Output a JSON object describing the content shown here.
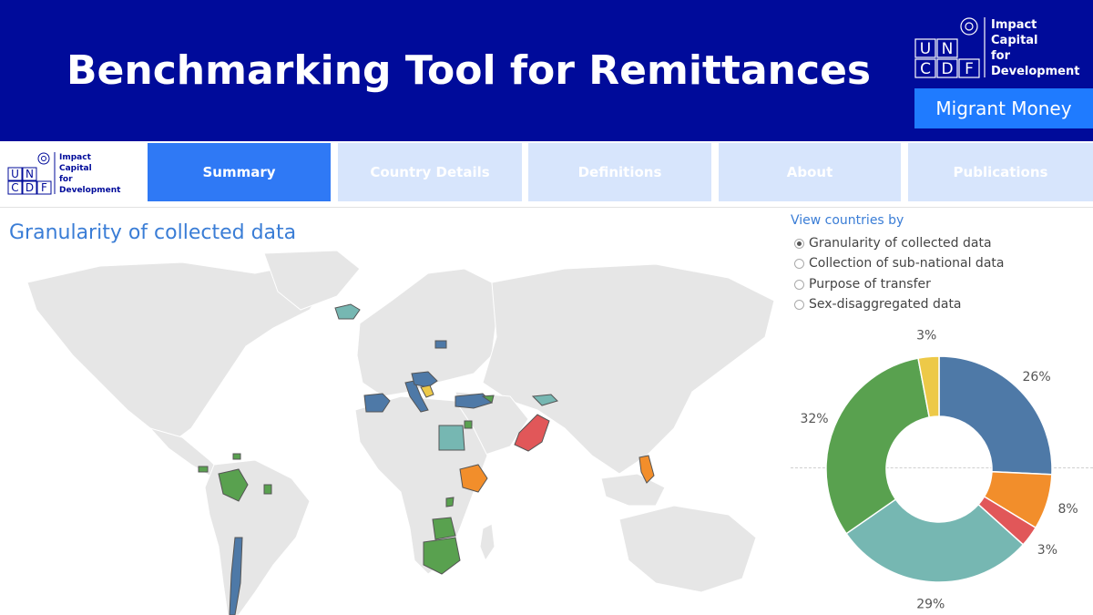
{
  "header": {
    "title": "Benchmarking Tool for Remittances",
    "badge": "Migrant Money"
  },
  "logo": {
    "letters_top": "UN",
    "letters_bottom": "CDF",
    "lines": [
      "Impact",
      "Capital",
      "for",
      "Development"
    ]
  },
  "nav": {
    "tabs": [
      {
        "label": "Summary",
        "active": true
      },
      {
        "label": "Country Details",
        "active": false
      },
      {
        "label": "Definitions",
        "active": false
      },
      {
        "label": "About",
        "active": false
      },
      {
        "label": "Publications",
        "active": false
      }
    ]
  },
  "main": {
    "section_title": "Granularity of collected data"
  },
  "filter": {
    "title": "View countries by",
    "options": [
      {
        "label": "Granularity of collected data",
        "selected": true
      },
      {
        "label": "Collection of sub-national data",
        "selected": false
      },
      {
        "label": "Purpose of transfer",
        "selected": false
      },
      {
        "label": "Sex-disaggregated data",
        "selected": false
      }
    ]
  },
  "colors": {
    "header": "#000b9a",
    "accent": "#1f7bff",
    "tab_active": "#2f79f5",
    "tab_inactive": "#d7e5fc",
    "title_blue": "#3a7dd6"
  },
  "chart_data": {
    "type": "pie",
    "donut": true,
    "slices": [
      {
        "label": "26%",
        "value": 26,
        "color": "#4e79a7"
      },
      {
        "label": "8%",
        "value": 8,
        "color": "#f28e2b"
      },
      {
        "label": "3%",
        "value": 3,
        "color": "#e15759"
      },
      {
        "label": "29%",
        "value": 29,
        "color": "#76b7b2"
      },
      {
        "label": "32%",
        "value": 32,
        "color": "#59a14f"
      },
      {
        "label": "3%",
        "value": 3,
        "color": "#edc948"
      }
    ]
  }
}
